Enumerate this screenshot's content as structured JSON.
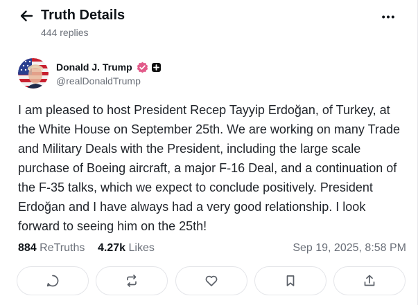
{
  "header": {
    "title": "Truth Details",
    "replies": "444 replies"
  },
  "author": {
    "name": "Donald J. Trump",
    "handle": "@realDonaldTrump",
    "verified_color": "#e25b8a"
  },
  "post": {
    "text": "I am pleased to host President Recep Tayyip Erdoğan, of Turkey, at the White House on September 25th. We are working on many Trade and Military Deals with the President, including the large scale purchase of Boeing aircraft, a major F-16 Deal, and a continuation of the F-35 talks, which we expect to conclude positively. President Erdoğan and I have always had a very good relationship. I look forward to seeing him on the 25th!"
  },
  "stats": {
    "retruths_count": "884",
    "retruths_label": "ReTruths",
    "likes_count": "4.27k",
    "likes_label": "Likes",
    "timestamp": "Sep 19, 2025, 8:58 PM"
  },
  "actions": [
    {
      "name": "reply",
      "icon": "comment-icon"
    },
    {
      "name": "retruth",
      "icon": "repost-icon"
    },
    {
      "name": "like",
      "icon": "heart-icon"
    },
    {
      "name": "bookmark",
      "icon": "bookmark-icon"
    },
    {
      "name": "share",
      "icon": "share-icon"
    }
  ],
  "colors": {
    "text": "#0f1419",
    "muted": "#6b7079",
    "border": "#e4e5e9"
  }
}
